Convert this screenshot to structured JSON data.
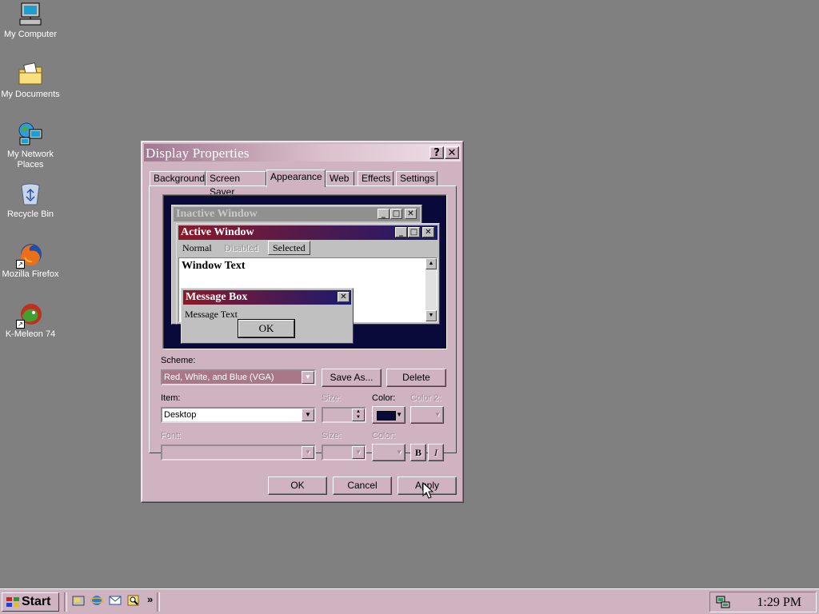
{
  "desktop": {
    "icons": [
      {
        "label": "My Computer"
      },
      {
        "label": "My Documents"
      },
      {
        "label": "My Network Places"
      },
      {
        "label": "Recycle Bin"
      },
      {
        "label": "Mozilla Firefox"
      },
      {
        "label": "K-Meleon 74"
      }
    ]
  },
  "dialog": {
    "title": "Display Properties",
    "help_glyph": "?",
    "close_glyph": "✕",
    "tabs": [
      "Background",
      "Screen Saver",
      "Appearance",
      "Web",
      "Effects",
      "Settings"
    ],
    "active_tab": "Appearance",
    "preview": {
      "inactive_title": "Inactive Window",
      "active_title": "Active Window",
      "menu": {
        "normal": "Normal",
        "disabled": "Disabled",
        "selected": "Selected"
      },
      "window_text": "Window Text",
      "msgbox_title": "Message Box",
      "msgbox_text": "Message Text",
      "msgbox_ok": "OK"
    },
    "scheme_label": "Scheme:",
    "scheme_value": "Red, White, and Blue (VGA)",
    "save_as_label": "Save As...",
    "delete_label": "Delete",
    "item_label": "Item:",
    "item_value": "Desktop",
    "item_size_label": "Size:",
    "color_label": "Color:",
    "color_value": "#0a0a3a",
    "color2_label": "Color 2:",
    "font_label": "Font:",
    "font_size_label": "Size:",
    "font_color_label": "Color:",
    "bold_label": "B",
    "italic_label": "I",
    "ok_label": "OK",
    "cancel_label": "Cancel",
    "apply_label": "Apply"
  },
  "taskbar": {
    "start_label": "Start",
    "clock": "1:29 PM"
  },
  "colors": {
    "desktop": "#808080",
    "face": "#cfb3c0",
    "active_title_start": "#8b1a2a",
    "active_title_end": "#1a1a6e"
  }
}
